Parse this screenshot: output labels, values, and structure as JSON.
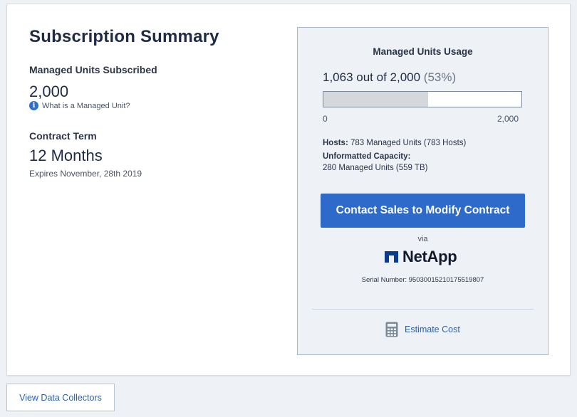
{
  "summary": {
    "title": "Subscription Summary",
    "managed_units_label": "Managed Units Subscribed",
    "managed_units_value": "2,000",
    "info_link": "What is a Managed Unit?",
    "contract_term_label": "Contract Term",
    "contract_term_value": "12 Months",
    "expires": "Expires November, 28th 2019"
  },
  "usage": {
    "title": "Managed Units Usage",
    "text": "1,063 out of 2,000",
    "percent_text": "(53%)",
    "used": 1063,
    "total": 2000,
    "fraction": 0.53,
    "min_label": "0",
    "max_label": "2,000",
    "hosts_label": "Hosts:",
    "hosts_value": "783 Managed Units (783 Hosts)",
    "unformatted_label": "Unformatted Capacity:",
    "unformatted_value": "280 Managed Units (559 TB)"
  },
  "contact": {
    "button_label": "Contact Sales to Modify Contract",
    "via": "via",
    "brand": "NetApp",
    "serial": "Serial Number: 950300152101755198​07"
  },
  "estimate": {
    "label": "Estimate Cost",
    "icon": "calculator-icon"
  },
  "footer": {
    "view_collectors": "View Data Collectors"
  },
  "colors": {
    "accent": "#2d6ac9",
    "title": "#1f2b45",
    "link": "#2d5fa8",
    "panel_bg": "#eef1f5",
    "bar_fill": "#d4d7dc"
  }
}
